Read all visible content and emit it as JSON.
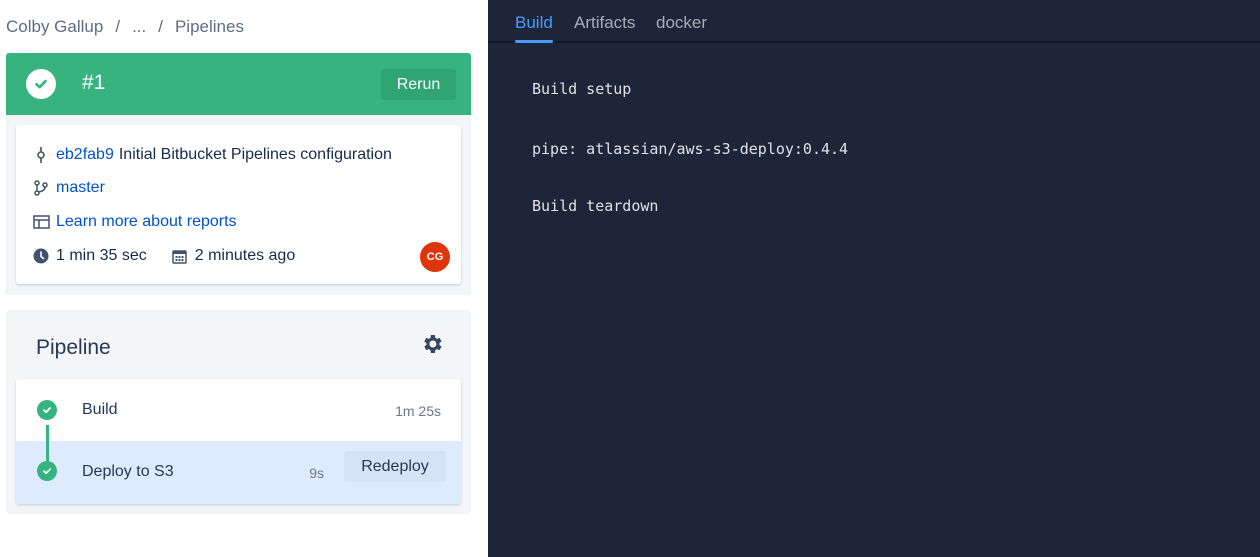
{
  "breadcrumb": {
    "items": [
      "Colby Gallup",
      "...",
      "Pipelines"
    ],
    "separator": "/"
  },
  "status": {
    "state": "success",
    "run_number": "#1",
    "rerun_label": "Rerun",
    "color": "#36b37e"
  },
  "commit": {
    "hash": "eb2fab9",
    "message": "Initial Bitbucket Pipelines configuration",
    "branch": "master",
    "reports_link": "Learn more about reports",
    "duration": "1 min 35 sec",
    "time_ago": "2 minutes ago",
    "avatar_initials": "CG",
    "avatar_color": "#de350b"
  },
  "pipeline": {
    "title": "Pipeline",
    "steps": [
      {
        "name": "Build",
        "duration": "1m 25s",
        "status": "success",
        "active": false
      },
      {
        "name": "Deploy to S3",
        "duration": "9s",
        "status": "success",
        "active": true,
        "action_label": "Redeploy"
      }
    ]
  },
  "log_panel": {
    "tabs": [
      {
        "label": "Build",
        "active": true
      },
      {
        "label": "Artifacts",
        "active": false
      },
      {
        "label": "docker",
        "active": false
      }
    ],
    "lines": [
      "Build setup",
      "pipe: atlassian/aws-s3-deploy:0.4.4",
      "Build teardown"
    ]
  }
}
